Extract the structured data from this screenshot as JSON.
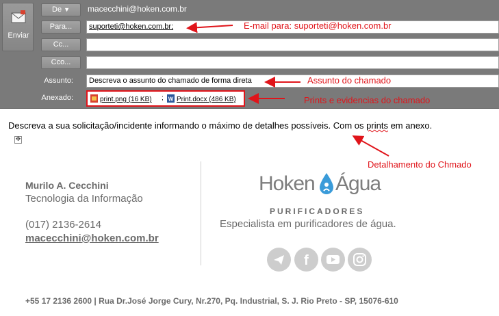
{
  "compose": {
    "send_label": "Enviar",
    "from_button": "De",
    "from_value": "macecchini@hoken.com.br",
    "to_button": "Para...",
    "to_value": "suporteti@hoken.com.br;",
    "cc_button": "Cc...",
    "bcc_button": "Cco...",
    "subject_label": "Assunto:",
    "subject_value": "Descreva o assunto do chamado de forma direta",
    "attached_label": "Anexado:",
    "attachments": [
      {
        "name": "print.png (16 KB)",
        "type": "image"
      },
      {
        "name": "Print.docx (486 KB)",
        "type": "word"
      }
    ],
    "attachment_separator": ";"
  },
  "annotations": {
    "to": "E-mail para: suporteti@hoken.com.br",
    "subject": "Assunto do chamado",
    "attachments": "Prints e evidencias do chamado",
    "body": "Detalhamento do Chmado"
  },
  "body": {
    "text_before": "Descreva a sua solicitação/incidente informando o máximo de detalhes possíveis. Com os ",
    "text_misspelled": "prints",
    "text_after": " em anexo."
  },
  "signature": {
    "name": "Murilo A. Cecchini",
    "department": "Tecnologia da Informação",
    "phone": "(017) 2136-2614",
    "email": "macecchini@hoken.com.br",
    "logo_left": "Hoken",
    "logo_right": "Água",
    "tagline": "PURIFICADORES",
    "description": "Especialista em purificadores de água.",
    "social_icons": [
      "telegram-icon",
      "facebook-icon",
      "youtube-icon",
      "instagram-icon"
    ],
    "footer": "+55 17 2136 2600 | Rua Dr.José Jorge Cury, Nr.270, Pq. Industrial, S. J. Rio Preto - SP, 15076-610"
  },
  "colors": {
    "header_bg": "#7a7a7a",
    "annotation_red": "#e0141a",
    "signature_gray": "#6a6a6a",
    "logo_blue": "#3a9bd9"
  }
}
